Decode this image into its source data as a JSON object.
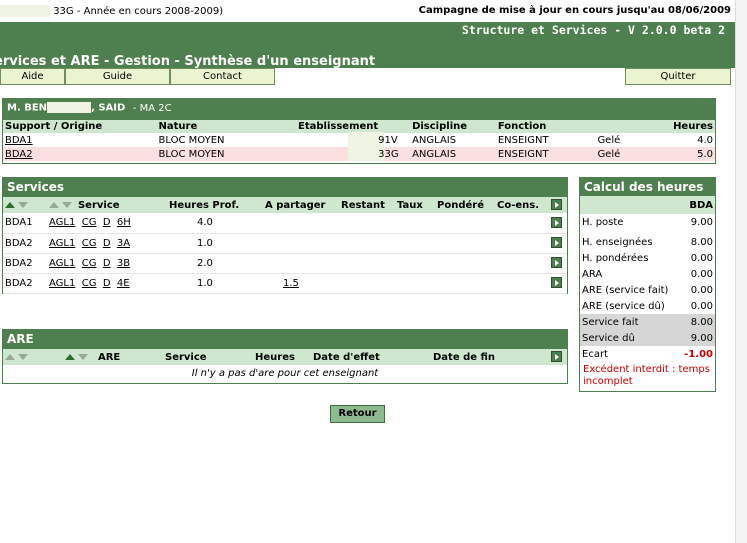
{
  "topbar": {
    "context": "33G - Année en cours 2008-2009)",
    "campaign": "Campagne de mise à jour en cours jusqu'au 08/06/2009"
  },
  "banner": {
    "version": "Structure et Services - V 2.0.0 beta 2",
    "title": "ervices et ARE - Gestion - Synthèse d'un enseignant"
  },
  "menu": {
    "aide": "Aide",
    "guide": "Guide",
    "contact": "Contact",
    "quitter": "Quitter"
  },
  "teacher": {
    "name_prefix": "M. BEN",
    "name_suffix": ", SAID",
    "grade": "- MA 2C",
    "columns": [
      "Support / Origine",
      "Nature",
      "Etablissement",
      "Discipline",
      "Fonction",
      "Heures"
    ],
    "rows": [
      {
        "support": "BDA1",
        "nature": "BLOC MOYEN",
        "etab": "91V",
        "discipline": "ANGLAIS",
        "fonction": "ENSEIGNT",
        "etat": "Gelé",
        "heures": "4.0"
      },
      {
        "support": "BDA2",
        "nature": "BLOC MOYEN",
        "etab": "33G",
        "discipline": "ANGLAIS",
        "fonction": "ENSEIGNT",
        "etat": "Gelé",
        "heures": "5.0"
      }
    ]
  },
  "services": {
    "title": "Services",
    "columns": {
      "service": "Service",
      "heures_prof": "Heures Prof.",
      "a_partager": "A partager",
      "restant": "Restant",
      "taux": "Taux",
      "pondere": "Pondéré",
      "coens": "Co-ens."
    },
    "rows": [
      {
        "support": "BDA1",
        "c1": "AGL1",
        "c2": "CG",
        "c3": "D",
        "c4": "6H",
        "heures": "4.0",
        "partager": ""
      },
      {
        "support": "BDA2",
        "c1": "AGL1",
        "c2": "CG",
        "c3": "D",
        "c4": "3A",
        "heures": "1.0",
        "partager": ""
      },
      {
        "support": "BDA2",
        "c1": "AGL1",
        "c2": "CG",
        "c3": "D",
        "c4": "3B",
        "heures": "2.0",
        "partager": ""
      },
      {
        "support": "BDA2",
        "c1": "AGL1",
        "c2": "CG",
        "c3": "D",
        "c4": "4E",
        "heures": "1.0",
        "partager": "1.5"
      }
    ]
  },
  "are": {
    "title": "ARE",
    "columns": {
      "are": "ARE",
      "service": "Service",
      "heures": "Heures",
      "date_effet": "Date d'effet",
      "date_fin": "Date de fin"
    },
    "empty": "Il n'y a pas d'are pour cet enseignant"
  },
  "calc": {
    "title": "Calcul des heures",
    "column": "BDA",
    "rows": [
      {
        "label": "H. poste",
        "value": "9.00"
      },
      {
        "label": "H. enseignées",
        "value": "8.00"
      },
      {
        "label": "H. pondérées",
        "value": "0.00"
      },
      {
        "label": "ARA",
        "value": "0.00"
      },
      {
        "label": "ARE (service fait)",
        "value": "0.00"
      },
      {
        "label": "ARE (service dû)",
        "value": "0.00"
      },
      {
        "label": "Service fait",
        "value": "8.00"
      },
      {
        "label": "Service dû",
        "value": "9.00"
      },
      {
        "label": "Ecart",
        "value": "-1.00"
      }
    ],
    "warning": "Excédent interdit : temps incomplet"
  },
  "retour": "Retour",
  "colors": {
    "accent": "#4e7f4e",
    "light": "#ebf4d0",
    "pink": "#fbe0e0",
    "warning": "#cc0000"
  }
}
